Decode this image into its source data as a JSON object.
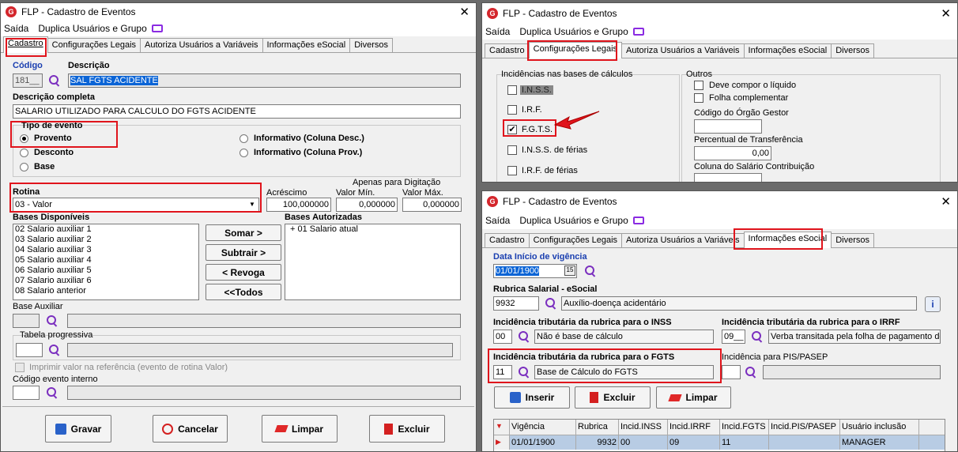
{
  "win1": {
    "title": "FLP - Cadastro de Eventos",
    "menu": [
      "Saída",
      "Duplica Usuários e Grupo"
    ],
    "tabs": [
      "Cadastro",
      "Configurações Legais",
      "Autoriza Usuários a Variáveis",
      "Informações eSocial",
      "Diversos"
    ],
    "codigo_label": "Código",
    "codigo_value": "181__",
    "descricao_label": "Descrição",
    "descricao_value": "SAL FGTS ACIDENTE",
    "desc_completa_label": "Descrição completa",
    "desc_completa_value": "SALARIO UTILIZADO PARA CALCULO DO FGTS ACIDENTE",
    "tipo_label": "Tipo de evento",
    "tipo_options": [
      "Provento",
      "Desconto",
      "Base",
      "Informativo (Coluna Desc.)",
      "Informativo (Coluna Prov.)"
    ],
    "rotina_label": "Rotina",
    "rotina_value": "03 - Valor",
    "acrescimo_label": "Acréscimo",
    "acrescimo_value": "100,000000",
    "apenas_label": "Apenas para Digitação",
    "valor_min_label": "Valor Mín.",
    "valor_min_value": "0,000000",
    "valor_max_label": "Valor Máx.",
    "valor_max_value": "0,000000",
    "bases_disp_label": "Bases Disponíveis",
    "bases_disp": [
      "02 Salario auxiliar 1",
      "03 Salario auxiliar 2",
      "04 Salario auxiliar 3",
      "05 Salario auxiliar 4",
      "06 Salario auxiliar 5",
      "07 Salario auxiliar 6",
      "08 Salario anterior"
    ],
    "bases_aut_label": "Bases Autorizadas",
    "bases_aut": [
      "+ 01 Salario atual"
    ],
    "btn_somar": "Somar >",
    "btn_subtrair": "Subtrair >",
    "btn_revoga": "< Revoga",
    "btn_todos": "<<Todos",
    "base_aux_label": "Base Auxiliar",
    "tabela_label": "Tabela progressiva",
    "imprimir_label": "Imprimir valor na referência (evento de rotina Valor)",
    "cod_interno_label": "Código evento interno",
    "btn_gravar": "Gravar",
    "btn_cancelar": "Cancelar",
    "btn_limpar": "Limpar",
    "btn_excluir": "Excluir"
  },
  "win2": {
    "title": "FLP - Cadastro de Eventos",
    "menu": [
      "Saída",
      "Duplica Usuários e Grupo"
    ],
    "tabs": [
      "Cadastro",
      "Configurações Legais",
      "Autoriza Usuários a Variáveis",
      "Informações eSocial",
      "Diversos"
    ],
    "incid_label": "Incidências nas bases de cálculos",
    "incid": [
      "I.N.S.S.",
      "I.R.F.",
      "F.G.T.S.",
      "I.N.S.S. de férias",
      "I.R.F. de férias"
    ],
    "outros_label": "Outros",
    "deve_label": "Deve compor o líquido",
    "folha_label": "Folha complementar",
    "orgao_label": "Código do Órgão Gestor",
    "percentual_label": "Percentual de Transferência",
    "percentual_value": "0,00",
    "coluna_label": "Coluna do Salário Contribuição"
  },
  "win3": {
    "title": "FLP - Cadastro de Eventos",
    "menu": [
      "Saída",
      "Duplica Usuários e Grupo"
    ],
    "tabs": [
      "Cadastro",
      "Configurações Legais",
      "Autoriza Usuários a Variáveis",
      "Informações eSocial",
      "Diversos"
    ],
    "data_label": "Data Início de vigência",
    "data_value": "01/01/1900",
    "rubrica_label": "Rubrica Salarial - eSocial",
    "rubrica_code": "9932",
    "rubrica_desc": "Auxílio-doença acidentário",
    "inss_label": "Incidência tributária da rubrica para o INSS",
    "inss_code": "00",
    "inss_desc": "Não é base de cálculo",
    "irrf_label": "Incidência tributária da rubrica para o IRRF",
    "irrf_code": "09__",
    "irrf_desc": "Verba transitada pela folha de pagamento de",
    "fgts_label": "Incidência tributária da rubrica para o FGTS",
    "fgts_code": "11",
    "fgts_desc": "Base de Cálculo do FGTS",
    "pis_label": "Incidência para PIS/PASEP",
    "btn_inserir": "Inserir",
    "btn_excluir": "Excluir",
    "btn_limpar": "Limpar",
    "grid_headers": [
      "Vigência",
      "Rubrica",
      "Incid.INSS",
      "Incid.IRRF",
      "Incid.FGTS",
      "Incid.PIS/PASEP",
      "Usuário inclusão"
    ],
    "grid_row": [
      "01/01/1900",
      "9932",
      "00",
      "09",
      "11",
      "",
      "MANAGER"
    ]
  },
  "colors": {
    "highlight": "#e0141c",
    "selection": "#0a64d6",
    "accent": "#1a3fb0"
  }
}
